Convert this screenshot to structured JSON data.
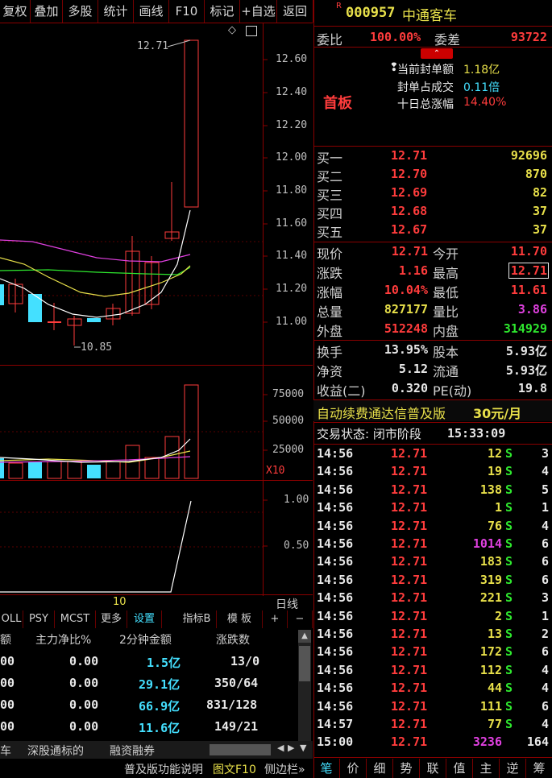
{
  "toolbar": [
    "复权",
    "叠加",
    "多股",
    "统计",
    "画线",
    "F10",
    "标记",
    "+自选",
    "返回"
  ],
  "price_axis": [
    "12.60",
    "12.40",
    "12.20",
    "12.00",
    "11.80",
    "11.60",
    "11.40",
    "11.20",
    "11.00"
  ],
  "annot_high": "12.71",
  "annot_low": "10.85",
  "vol_axis": [
    "75000",
    "50000",
    "25000"
  ],
  "vol_unit": "X10",
  "ind_axis": [
    "1.00",
    "0.50"
  ],
  "date_label": "10",
  "period": "日线",
  "tabs": [
    "OLL",
    "PSY",
    "MCST",
    "更多",
    "设置",
    "指标B",
    "模 板",
    "+",
    "−"
  ],
  "flow_headers": [
    "额",
    "主力净比%",
    "2分钟金额",
    "涨跌数"
  ],
  "flow_rows": [
    [
      "00",
      "0.00",
      "1.5亿",
      "13/0"
    ],
    [
      "00",
      "0.00",
      "29.1亿",
      "350/64"
    ],
    [
      "00",
      "0.00",
      "66.9亿",
      "831/128"
    ],
    [
      "00",
      "0.00",
      "11.6亿",
      "149/21"
    ]
  ],
  "bottom_nav": [
    "车",
    "深股通标的",
    "融资融券"
  ],
  "status_left": [
    "普及版功能说明",
    "图文F10",
    "侧边栏»"
  ],
  "stock": {
    "badge": "R",
    "code": "000957",
    "name": "中通客车"
  },
  "weibi": {
    "label": "委比",
    "value": "100.00%",
    "label2": "委差",
    "value2": "93722"
  },
  "board": {
    "title": "首板",
    "l1": "当前封单额",
    "v1": "1.18亿",
    "l2": "封单占成交",
    "v2": "0.11倍",
    "l3": "十日总涨幅",
    "v3": "14.40%"
  },
  "bids": [
    {
      "label": "买一",
      "price": "12.71",
      "vol": "92696"
    },
    {
      "label": "买二",
      "price": "12.70",
      "vol": "870"
    },
    {
      "label": "买三",
      "price": "12.69",
      "vol": "82"
    },
    {
      "label": "买四",
      "price": "12.68",
      "vol": "37"
    },
    {
      "label": "买五",
      "price": "12.67",
      "vol": "37"
    }
  ],
  "quote": [
    {
      "l": "现价",
      "v": "12.71",
      "l2": "今开",
      "v2": "11.70"
    },
    {
      "l": "涨跌",
      "v": "1.16",
      "l2": "最高",
      "v2": "12.71"
    },
    {
      "l": "涨幅",
      "v": "10.04%",
      "l2": "最低",
      "v2": "11.61"
    },
    {
      "l": "总量",
      "v": "827177",
      "l2": "量比",
      "v2": "3.86"
    },
    {
      "l": "外盘",
      "v": "512248",
      "l2": "内盘",
      "v2": "314929"
    }
  ],
  "fin": [
    {
      "l": "换手",
      "v": "13.95%",
      "l2": "股本",
      "v2": "5.93亿"
    },
    {
      "l": "净资",
      "v": "5.12",
      "l2": "流通",
      "v2": "5.93亿"
    },
    {
      "l": "收益(二)",
      "v": "0.320",
      "l2": "PE(动)",
      "v2": "19.8"
    }
  ],
  "ad": {
    "text": "自动续费通达信普及版",
    "price": "30元/月"
  },
  "trade_status": {
    "label": "交易状态: 闭市阶段",
    "time": "15:33:09"
  },
  "ticks": [
    {
      "t": "14:56",
      "p": "12.71",
      "v": "12",
      "s": "S",
      "n": "3"
    },
    {
      "t": "14:56",
      "p": "12.71",
      "v": "19",
      "s": "S",
      "n": "4"
    },
    {
      "t": "14:56",
      "p": "12.71",
      "v": "138",
      "s": "S",
      "n": "5"
    },
    {
      "t": "14:56",
      "p": "12.71",
      "v": "1",
      "s": "S",
      "n": "1"
    },
    {
      "t": "14:56",
      "p": "12.71",
      "v": "76",
      "s": "S",
      "n": "4"
    },
    {
      "t": "14:56",
      "p": "12.71",
      "v": "1014",
      "s": "S",
      "n": "6"
    },
    {
      "t": "14:56",
      "p": "12.71",
      "v": "183",
      "s": "S",
      "n": "6"
    },
    {
      "t": "14:56",
      "p": "12.71",
      "v": "319",
      "s": "S",
      "n": "6"
    },
    {
      "t": "14:56",
      "p": "12.71",
      "v": "221",
      "s": "S",
      "n": "3"
    },
    {
      "t": "14:56",
      "p": "12.71",
      "v": "2",
      "s": "S",
      "n": "1"
    },
    {
      "t": "14:56",
      "p": "12.71",
      "v": "13",
      "s": "S",
      "n": "2"
    },
    {
      "t": "14:56",
      "p": "12.71",
      "v": "172",
      "s": "S",
      "n": "6"
    },
    {
      "t": "14:56",
      "p": "12.71",
      "v": "112",
      "s": "S",
      "n": "4"
    },
    {
      "t": "14:56",
      "p": "12.71",
      "v": "44",
      "s": "S",
      "n": "4"
    },
    {
      "t": "14:56",
      "p": "12.71",
      "v": "111",
      "s": "S",
      "n": "6"
    },
    {
      "t": "14:57",
      "p": "12.71",
      "v": "77",
      "s": "S",
      "n": "4"
    },
    {
      "t": "15:00",
      "p": "12.71",
      "v": "3236",
      "s": "",
      "n": "164"
    }
  ],
  "right_tabs": [
    "笔",
    "价",
    "细",
    "势",
    "联",
    "值",
    "主",
    "逆",
    "筹"
  ],
  "colors": {
    "up": "#ff3c3c",
    "down": "#44e0ff",
    "grid": "#8a0000",
    "bg": "#000000"
  }
}
